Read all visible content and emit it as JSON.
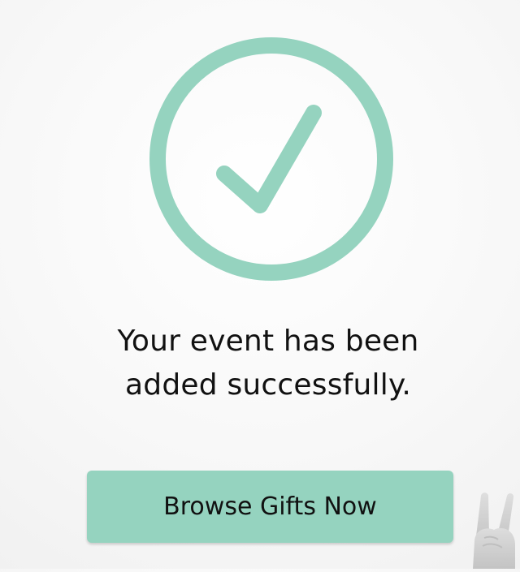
{
  "status_icon": {
    "name": "check-circle-icon",
    "color": "#95d3bf"
  },
  "message": {
    "line1": "Your event has been",
    "line2": "added successfully."
  },
  "primary_action": {
    "label": "Browse Gifts Now",
    "color": "#95d3bf"
  },
  "decoration": {
    "name": "hand-peace-icon"
  }
}
